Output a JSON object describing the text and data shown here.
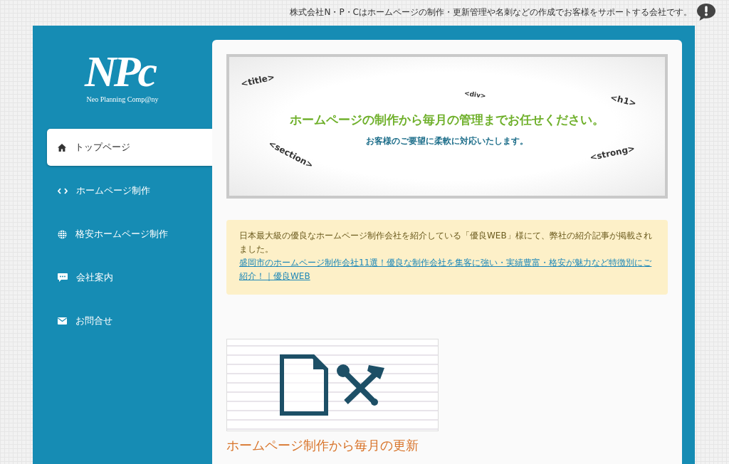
{
  "top_bar": {
    "tagline": "株式会社N・P・Cはホームページの制作・更新管理や名刺などの作成でお客様をサポートする会社です。"
  },
  "logo": {
    "mark": "NPc",
    "name": "Neo Planning Comp@ny"
  },
  "sidebar": {
    "items": [
      {
        "label": "トップページ",
        "kind": "home",
        "selected": true
      },
      {
        "label": "ホームページ制作",
        "kind": "code",
        "selected": false
      },
      {
        "label": "格安ホームページ制作",
        "kind": "globe",
        "selected": false
      },
      {
        "label": "会社案内",
        "kind": "chat",
        "selected": false
      },
      {
        "label": "お問合せ",
        "kind": "mail",
        "selected": false
      }
    ]
  },
  "banner": {
    "tags": [
      "<title>",
      "<div>",
      "<h1>",
      "<section>",
      "<strong>"
    ],
    "headline": "ホームページの制作から毎月の管理までお任せください。",
    "subline": "お客様のご要望に柔軟に対応いたします。"
  },
  "notice": {
    "text": "日本最大級の優良なホームページ制作会社を紹介している「優良WEB」様にて、弊社の紹介記事が掲載されました。",
    "link": "盛岡市のホームページ制作会社11選！優良な制作会社を集客に強い・実績豊富・格安が魅力など特徴別にご紹介！｜優良WEB"
  },
  "article": {
    "title": "ホームページ制作から毎月の更新"
  }
}
